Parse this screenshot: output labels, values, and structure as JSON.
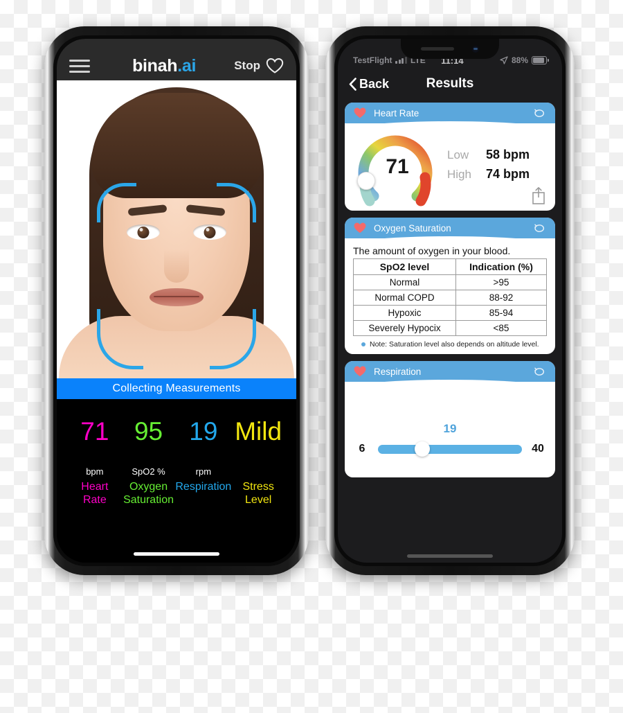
{
  "left_phone": {
    "app_bar": {
      "menu_icon": "hamburger-menu-icon",
      "brand_name": "binah",
      "brand_suffix": ".ai",
      "stop_label": "Stop",
      "favorite_icon": "heart-outline-icon"
    },
    "camera": {
      "overlay_icon": "face-detection-brackets",
      "bracket_color": "#2BA6E8"
    },
    "status_band": {
      "text": "Collecting Measurements",
      "background": "#0a82fb"
    },
    "metrics": [
      {
        "value": "71",
        "unit": "bpm",
        "name": "Heart\nRate",
        "name_line1": "Heart",
        "name_line2": "Rate",
        "color": "#FF00C8"
      },
      {
        "value": "95",
        "unit": "SpO2 %",
        "name": "Oxygen\nSaturation",
        "name_line1": "Oxygen",
        "name_line2": "Saturation",
        "color": "#66EE33"
      },
      {
        "value": "19",
        "unit": "rpm",
        "name": "Respiration",
        "name_line1": "Respiration",
        "name_line2": "",
        "color": "#23A8EC"
      },
      {
        "value": "Mild",
        "unit": "",
        "name": "Stress\nLevel",
        "name_line1": "Stress",
        "name_line2": "Level",
        "color": "#F2E610"
      }
    ]
  },
  "right_phone": {
    "status_bar": {
      "carrier": "TestFlight",
      "signal_icon": "cellular-bars-icon",
      "network": "LTE",
      "time": "11:14",
      "location_icon": "location-arrow-icon",
      "battery_percent": "88%",
      "battery_icon": "battery-icon"
    },
    "nav_bar": {
      "back_icon": "chevron-left-icon",
      "back_label": "Back",
      "title": "Results"
    },
    "cards": [
      {
        "id": "heart-rate",
        "header_icon": "heart-filled-icon",
        "title": "Heart Rate",
        "refresh_icon": "refresh-loop-icon",
        "gauge_value": "71",
        "stats": [
          {
            "label": "Low",
            "value": "58 bpm"
          },
          {
            "label": "High",
            "value": "74 bpm"
          }
        ],
        "share_icon": "share-icon"
      },
      {
        "id": "oxygen-saturation",
        "header_icon": "heart-filled-icon",
        "title": "Oxygen Saturation",
        "refresh_icon": "refresh-loop-icon",
        "description": "The amount of oxygen in your blood.",
        "table": {
          "headers": [
            "SpO2 level",
            "Indication (%)"
          ],
          "rows": [
            [
              "Normal",
              ">95"
            ],
            [
              "Normal COPD",
              "88-92"
            ],
            [
              "Hypoxic",
              "85-94"
            ],
            [
              "Severely Hypocix",
              "<85"
            ]
          ]
        },
        "note": "Note: Saturation level also depends on altitude level."
      },
      {
        "id": "respiration",
        "header_icon": "heart-filled-icon",
        "title": "Respiration",
        "refresh_icon": "refresh-loop-icon",
        "value": "19",
        "min": "6",
        "max": "40"
      }
    ]
  },
  "theme": {
    "card_header_blue": "#5BA7DC",
    "heart_red": "#F46A6A",
    "slider_blue": "#5BB1E4",
    "brand_blue": "#2BA6E8"
  },
  "chart_data": {
    "type": "gauge",
    "title": "Heart Rate",
    "value": 71,
    "unit": "bpm",
    "low": 58,
    "high": 74,
    "range": [
      40,
      160
    ],
    "arc_colors": [
      "#8fd3c8",
      "#6aa8dd",
      "#7fc06e",
      "#e8d23c",
      "#efa042",
      "#e2452e"
    ]
  }
}
